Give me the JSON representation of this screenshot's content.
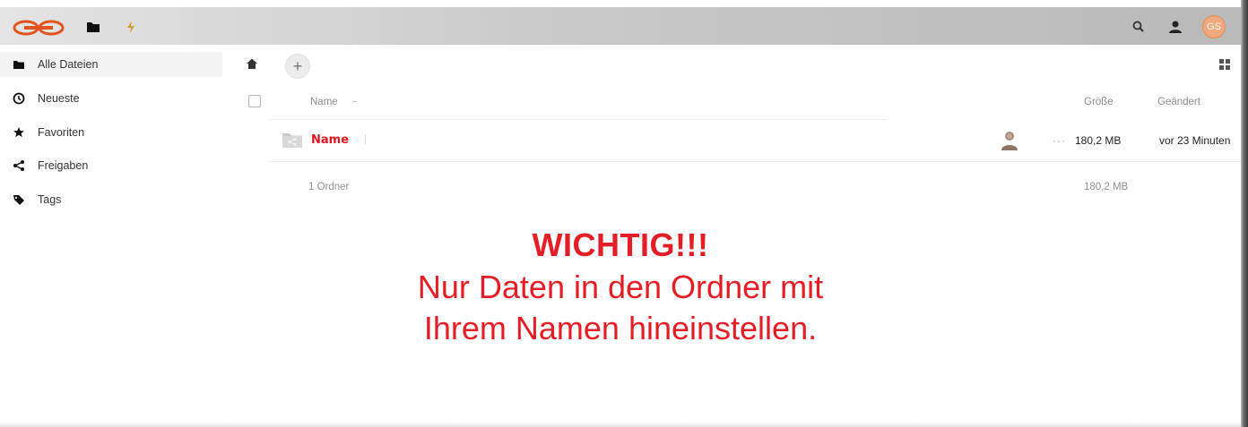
{
  "header": {
    "avatar_initials": "GS",
    "icons": [
      "logo-icon",
      "files-icon",
      "activity-icon",
      "search-icon",
      "contacts-icon"
    ],
    "colors": {
      "logo": "#e3531e",
      "avatar": "#f0a87c"
    }
  },
  "sidebar": {
    "items": [
      {
        "label": "Alle Dateien",
        "icon": "folder-icon",
        "active": true
      },
      {
        "label": "Neueste",
        "icon": "clock-icon"
      },
      {
        "label": "Favoriten",
        "icon": "star-icon"
      },
      {
        "label": "Freigaben",
        "icon": "share-icon"
      },
      {
        "label": "Tags",
        "icon": "tag-icon"
      }
    ]
  },
  "controls": {
    "add_label": "+"
  },
  "table": {
    "columns": {
      "name": "Name",
      "sort_indicator": "–",
      "size": "Größe",
      "modified": "Geändert"
    },
    "rows": [
      {
        "name": "Name",
        "size": "180,2 MB",
        "modified": "vor 23 Minuten",
        "actions": "···"
      }
    ],
    "summary": {
      "count": "1 Ordner",
      "size": "180,2 MB"
    }
  },
  "notice": {
    "title": "WICHTIG!!!",
    "line1": "Nur Daten in den Ordner mit",
    "line2": "Ihrem Namen hineinstellen.",
    "color": "#e41e26"
  }
}
